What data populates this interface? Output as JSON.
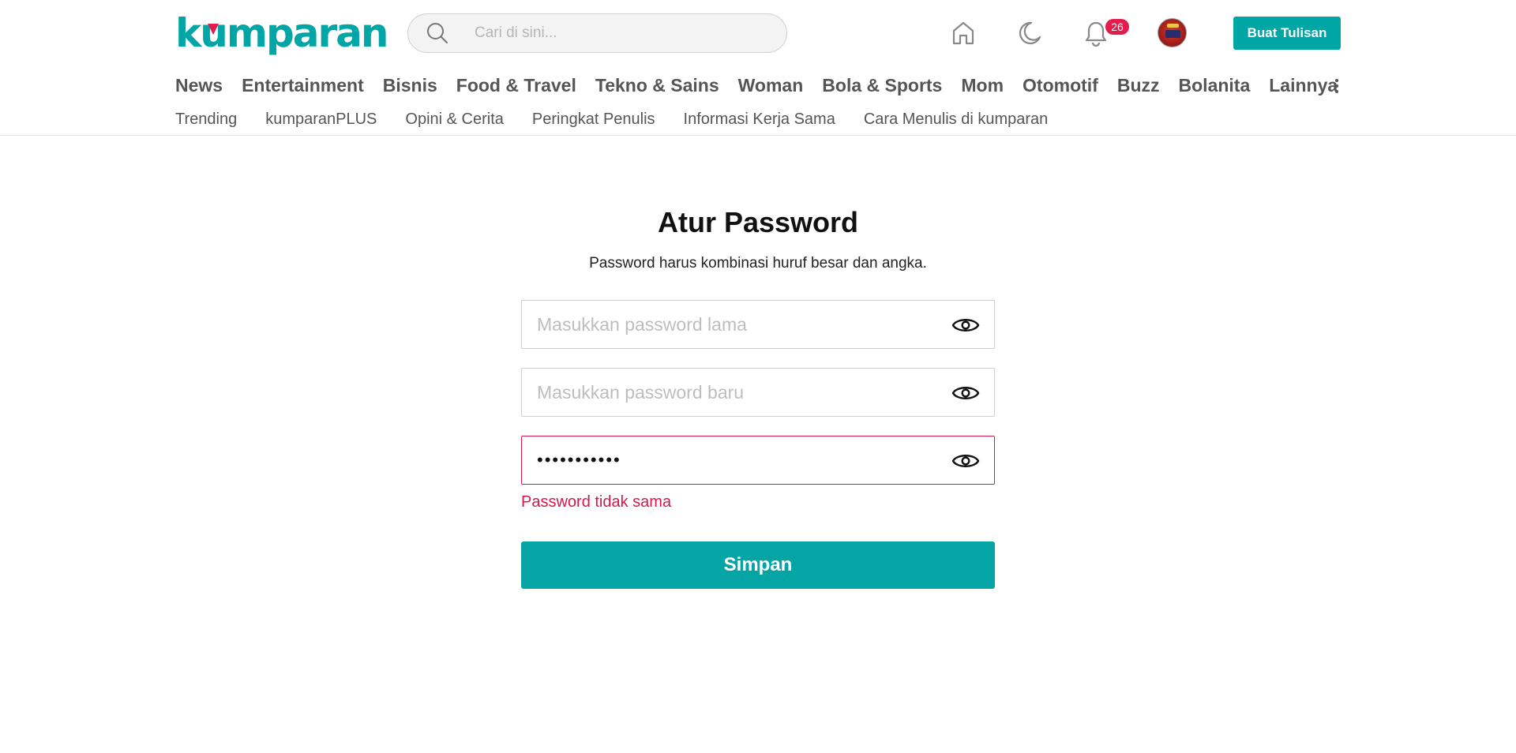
{
  "brand": {
    "logo_text": "kumparan",
    "accent_color": "#00a5a6",
    "error_color": "#d11a4a",
    "badge_color": "#e31c4c"
  },
  "header": {
    "search": {
      "placeholder": "Cari di sini...",
      "icon": "search-icon"
    },
    "icons": [
      "home-icon",
      "moon-icon",
      "bell-icon"
    ],
    "notification_count": "26",
    "write_button": "Buat Tulisan"
  },
  "nav": {
    "main": [
      "News",
      "Entertainment",
      "Bisnis",
      "Food & Travel",
      "Tekno & Sains",
      "Woman",
      "Bola & Sports",
      "Mom",
      "Otomotif",
      "Buzz",
      "Bolanita",
      "Lainnya"
    ],
    "sub": [
      "Trending",
      "kumparanPLUS",
      "Opini & Cerita",
      "Peringkat Penulis",
      "Informasi Kerja Sama",
      "Cara Menulis di kumparan"
    ]
  },
  "form": {
    "title": "Atur Password",
    "subtitle": "Password harus kombinasi huruf besar dan angka.",
    "old_password": {
      "placeholder": "Masukkan password lama",
      "value": ""
    },
    "new_password": {
      "placeholder": "Masukkan password baru",
      "value": ""
    },
    "confirm_password": {
      "value_masked": "•••••••••••"
    },
    "error_message": "Password tidak sama",
    "submit_label": "Simpan"
  }
}
